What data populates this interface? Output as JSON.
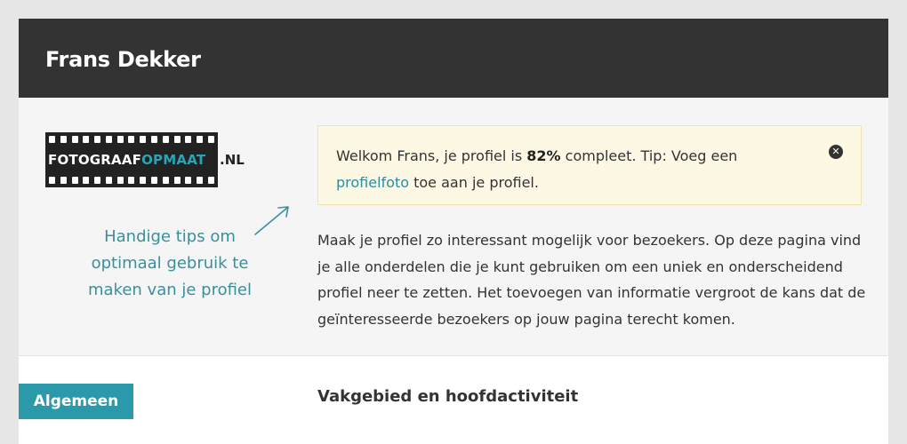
{
  "header": {
    "title": "Frans Dekker"
  },
  "logo": {
    "part1": "FOTOGRAAF",
    "part2": "OPMAAT",
    "tld": ".NL",
    "accent_color": "#2aa3b5"
  },
  "sidebar": {
    "tips": "Handige tips om optimaal gebruik te maken van je profiel"
  },
  "alert": {
    "text_before": "Welkom Frans, je profiel is ",
    "percent": "82%",
    "text_middle": " compleet. Tip: Voeg een ",
    "link": "profielfoto",
    "text_after": " toe aan je profiel.",
    "close_icon": "close-icon"
  },
  "intro": {
    "description": "Maak je profiel zo interessant mogelijk voor bezoekers. Op deze pagina vind je alle onderdelen die je kunt gebruiken om een uniek en onderscheidend profiel neer te zetten. Het toevoegen van informatie vergroot de kans dat de geïnteresseerde bezoekers op jouw pagina terecht komen."
  },
  "tabs": {
    "general": "Algemeen"
  },
  "section": {
    "title": "Vakgebied en hoofdactiviteit"
  },
  "colors": {
    "header_bg": "#333333",
    "accent": "#2a9aaa",
    "alert_bg": "#fcf8e3"
  }
}
